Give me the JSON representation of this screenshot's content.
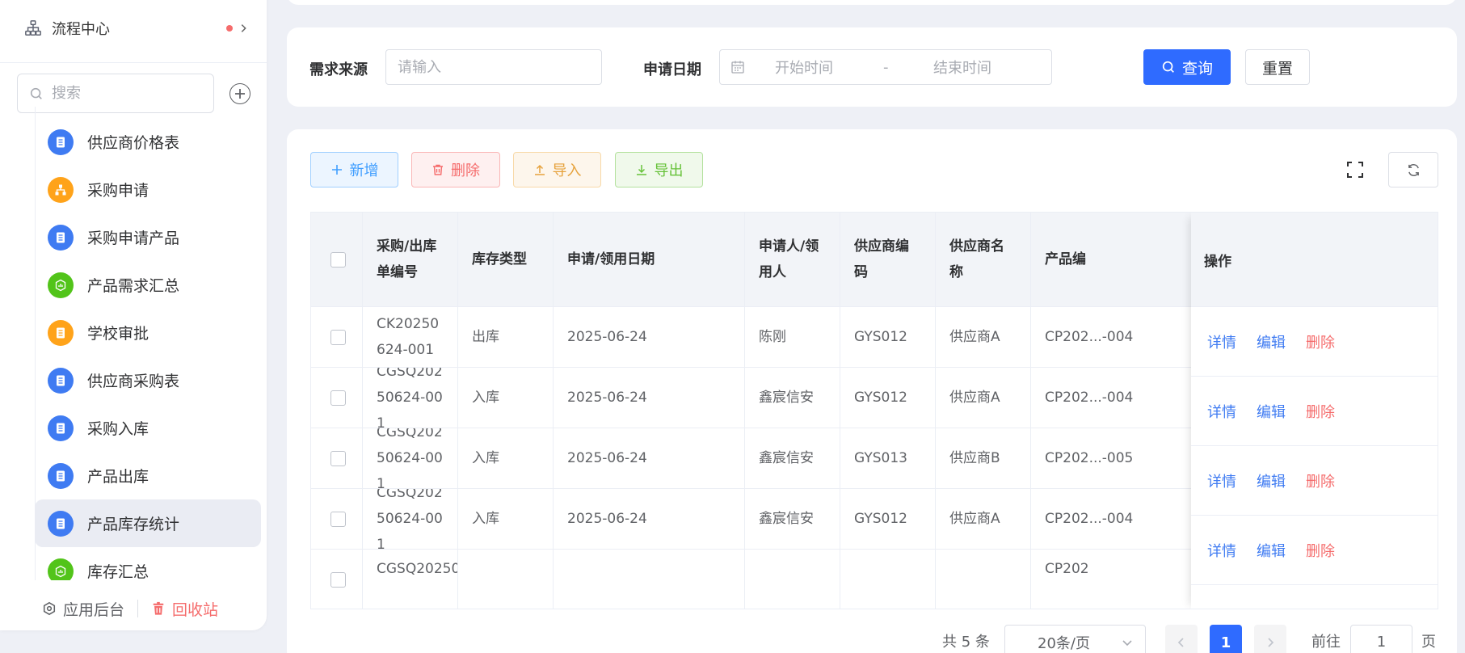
{
  "sidebar": {
    "flow_center": "流程中心",
    "search_placeholder": "搜索",
    "items": [
      {
        "label": "供应商价格表",
        "color": "#3f7bf2",
        "icon": "document-icon"
      },
      {
        "label": "采购申请",
        "color": "#ffa31a",
        "icon": "org-chart-icon"
      },
      {
        "label": "采购申请产品",
        "color": "#3f7bf2",
        "icon": "document-icon"
      },
      {
        "label": "产品需求汇总",
        "color": "#52c41a",
        "icon": "chart-icon"
      },
      {
        "label": "学校审批",
        "color": "#ffa31a",
        "icon": "document-icon"
      },
      {
        "label": "供应商采购表",
        "color": "#3f7bf2",
        "icon": "document-icon"
      },
      {
        "label": "采购入库",
        "color": "#3f7bf2",
        "icon": "document-icon"
      },
      {
        "label": "产品出库",
        "color": "#3f7bf2",
        "icon": "document-icon"
      },
      {
        "label": "产品库存统计",
        "color": "#3f7bf2",
        "icon": "document-icon",
        "active": true
      },
      {
        "label": "库存汇总",
        "color": "#52c41a",
        "icon": "chart-icon"
      }
    ],
    "footer": {
      "app_admin": "应用后台",
      "recycle_bin": "回收站"
    }
  },
  "filter": {
    "source_label": "需求来源",
    "source_placeholder": "请输入",
    "date_label": "申请日期",
    "start_placeholder": "开始时间",
    "range_sep": "-",
    "end_placeholder": "结束时间",
    "query_button": "查询",
    "reset_button": "重置"
  },
  "toolbar": {
    "add": "新增",
    "delete": "删除",
    "import": "导入",
    "export": "导出"
  },
  "table": {
    "columns": [
      "采购/出库单编号",
      "库存类型",
      "申请/领用日期",
      "申请人/领用人",
      "供应商编码",
      "供应商名称",
      "产品编",
      "操作"
    ],
    "rows": [
      {
        "order_no": "CK20250624-001",
        "type": "出库",
        "date": "2025-06-24",
        "person": "陈刚",
        "supplier_code": "GYS012",
        "supplier_name": "供应商A",
        "product": "CP202...-004"
      },
      {
        "order_no": "CGSQ20250624-001",
        "type": "入库",
        "date": "2025-06-24",
        "person": "鑫宸信安",
        "supplier_code": "GYS012",
        "supplier_name": "供应商A",
        "product": "CP202...-004"
      },
      {
        "order_no": "CGSQ20250624-001",
        "type": "入库",
        "date": "2025-06-24",
        "person": "鑫宸信安",
        "supplier_code": "GYS013",
        "supplier_name": "供应商B",
        "product": "CP202...-005"
      },
      {
        "order_no": "CGSQ20250624-001",
        "type": "入库",
        "date": "2025-06-24",
        "person": "鑫宸信安",
        "supplier_code": "GYS012",
        "supplier_name": "供应商A",
        "product": "CP202...-004"
      }
    ],
    "partial_row_order_no": "CGSQ20250",
    "partial_row_product": "CP202",
    "actions": {
      "detail": "详情",
      "edit": "编辑",
      "delete": "删除"
    }
  },
  "pagination": {
    "total": "共 5 条",
    "page_size": "20条/页",
    "current_page": "1",
    "goto_prefix": "前往",
    "goto_value": "1",
    "goto_suffix": "页"
  }
}
